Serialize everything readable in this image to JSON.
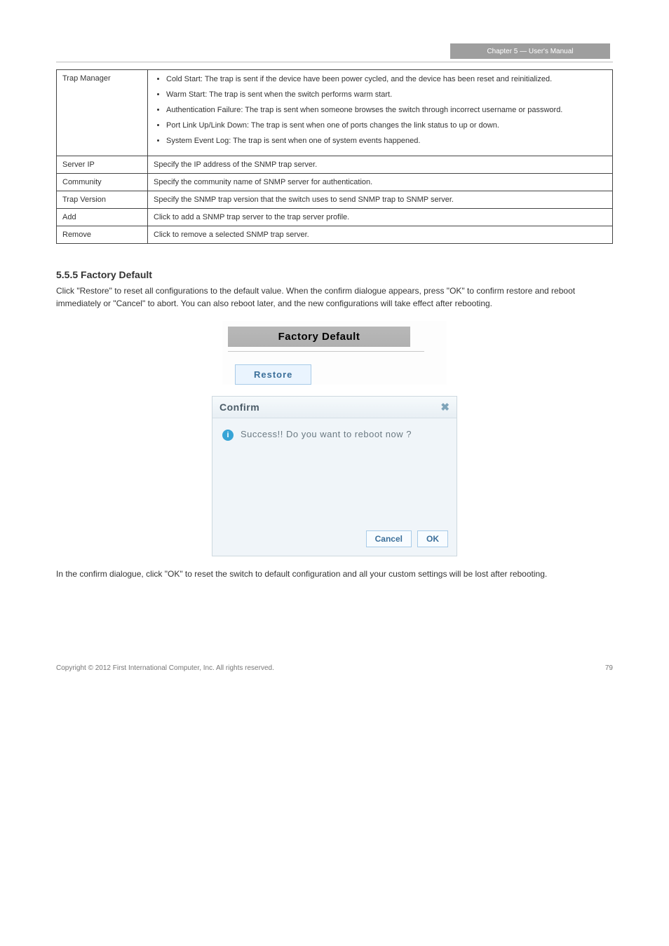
{
  "header": {
    "chapter_tag": "Chapter 5 — User's Manual"
  },
  "spec_table": {
    "rows": [
      {
        "label": "Trap Manager",
        "bullets": [
          "Cold Start: The trap is sent if the device have been power cycled, and the device has been reset and reinitialized.",
          "Warm Start: The trap is sent when the switch performs warm start.",
          "Authentication Failure: The trap is sent when someone browses the switch through incorrect username or password.",
          "Port Link Up/Link Down: The trap is sent when one of ports changes the link status to up or down.",
          "System Event Log: The trap is sent when one of system events happened."
        ]
      },
      {
        "label": "Server IP",
        "text": "Specify the IP address of the SNMP trap server."
      },
      {
        "label": "Community",
        "text": "Specify the community name of SNMP server for authentication."
      },
      {
        "label": "Trap Version",
        "text": "Specify the SNMP trap version that the switch uses to send SNMP trap to SNMP server."
      },
      {
        "label": "Add",
        "text": "Click to add a SNMP trap server to the trap server profile."
      },
      {
        "label": "Remove",
        "text": "Click to remove a selected SNMP trap server."
      }
    ]
  },
  "section": {
    "heading": "5.5.5 Factory Default",
    "p1": "Click \"Restore\" to reset all configurations to the default value. When the confirm dialogue appears, press \"OK\" to confirm restore and reboot immediately or \"Cancel\" to abort. You can also reboot later, and the new configurations will take effect after rebooting.",
    "p2": "In the confirm dialogue, click \"OK\" to reset the switch to default configuration and all your custom settings will be lost after rebooting."
  },
  "factory_default_panel": {
    "title": "Factory Default",
    "restore_label": "Restore"
  },
  "confirm_dialog": {
    "title": "Confirm",
    "message": "Success!! Do you want to reboot now ?",
    "cancel_label": "Cancel",
    "ok_label": "OK"
  },
  "footer": {
    "copyright": "Copyright © 2012 First International Computer, Inc. All rights reserved.",
    "page": "79"
  }
}
